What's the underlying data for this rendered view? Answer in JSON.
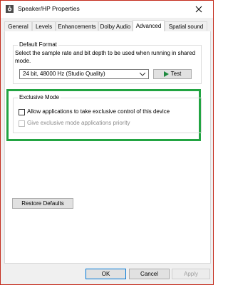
{
  "window": {
    "title": "Speaker/HP Properties"
  },
  "tabs": [
    "General",
    "Levels",
    "Enhancements",
    "Dolby Audio",
    "Advanced",
    "Spatial sound"
  ],
  "default_format": {
    "group_title": "Default Format",
    "description": "Select the sample rate and bit depth to be used when running in shared mode.",
    "selected_format": "24 bit, 48000 Hz (Studio Quality)",
    "test_button": "Test"
  },
  "exclusive_mode": {
    "group_title": "Exclusive Mode",
    "allow_exclusive_label": "Allow applications to take exclusive control of this device",
    "priority_label": "Give exclusive mode applications priority"
  },
  "restore_defaults_button": "Restore Defaults",
  "footer": {
    "ok_label": "OK",
    "cancel_label": "Cancel",
    "apply_label": "Apply"
  },
  "colors": {
    "highlight_outline": "#22a442",
    "window_border": "#c42b1c"
  },
  "icons": {
    "app": "speaker-icon",
    "close": "close-icon",
    "test": "play-icon",
    "dropdown": "chevron-down-icon"
  }
}
